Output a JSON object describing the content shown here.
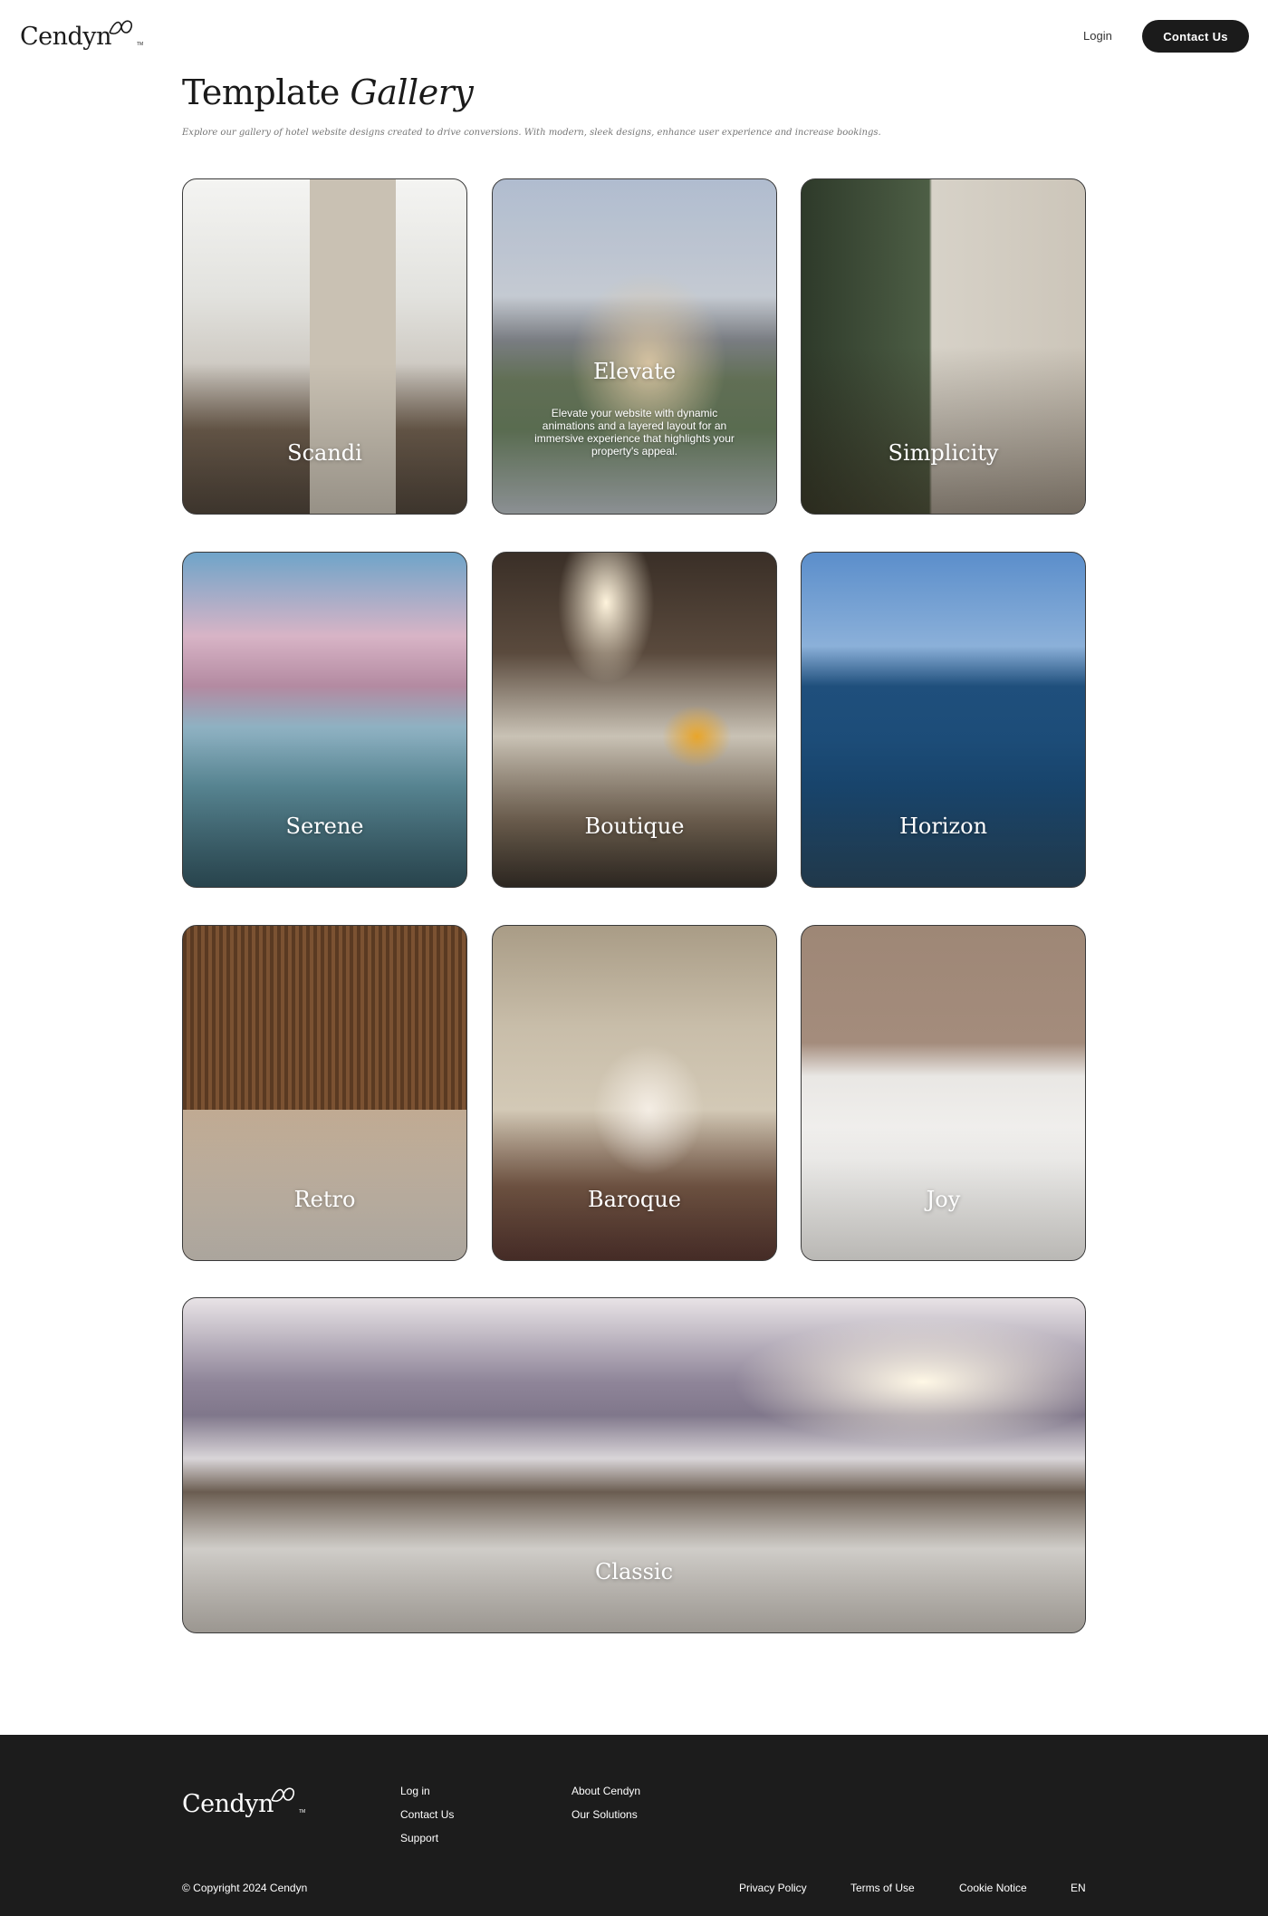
{
  "header": {
    "logo_text": "Cendyn",
    "logo_tm": "TM",
    "login_label": "Login",
    "contact_label": "Contact Us"
  },
  "page": {
    "title_regular": "Template ",
    "title_italic": "Gallery",
    "subtitle": "Explore our gallery of hotel website designs created to drive conversions. With modern, sleek designs, enhance user experience and increase bookings."
  },
  "templates": [
    {
      "name": "Scandi"
    },
    {
      "name": "Elevate",
      "description": "Elevate your website with dynamic animations and a layered layout for an immersive experience that highlights your property's appeal."
    },
    {
      "name": "Simplicity"
    },
    {
      "name": "Serene"
    },
    {
      "name": "Boutique"
    },
    {
      "name": "Horizon"
    },
    {
      "name": "Retro"
    },
    {
      "name": "Baroque"
    },
    {
      "name": "Joy"
    },
    {
      "name": "Classic"
    }
  ],
  "footer": {
    "logo_text": "Cendyn",
    "logo_tm": "TM",
    "col1": [
      "Log in",
      "Contact Us",
      "Support"
    ],
    "col2": [
      "About Cendyn",
      "Our Solutions"
    ],
    "copyright": "© Copyright 2024 Cendyn",
    "legal": [
      "Privacy Policy",
      "Terms of Use",
      "Cookie Notice"
    ],
    "language": "EN"
  },
  "colors": {
    "brand_dark": "#1b1b1b",
    "footer_bg": "#1c1c1c",
    "page_bg": "#ffffff"
  }
}
